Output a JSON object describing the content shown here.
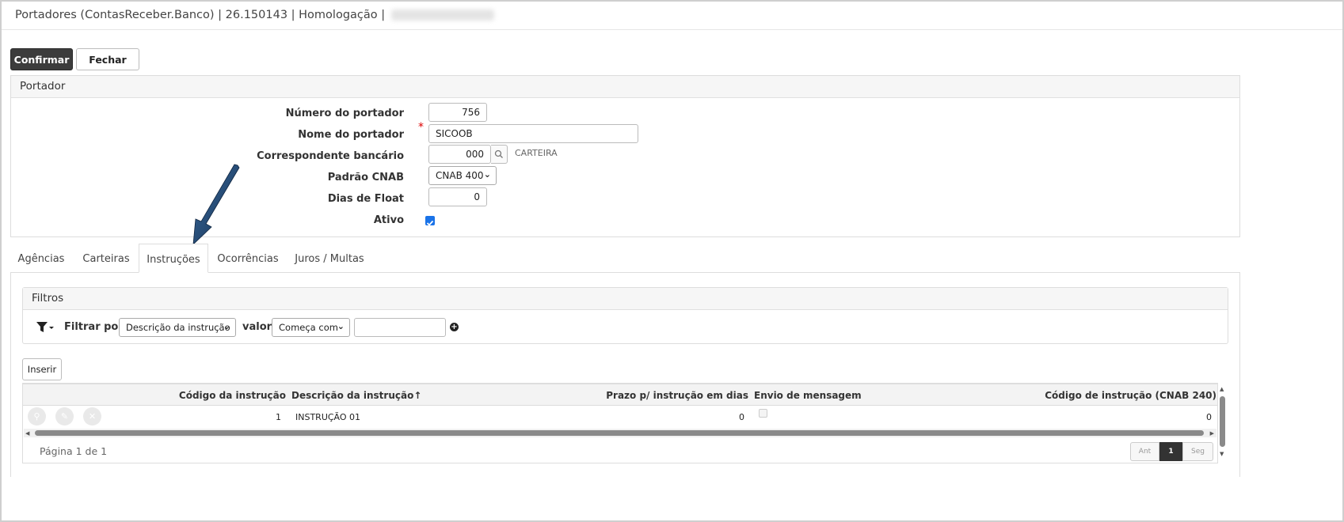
{
  "window": {
    "title": "Portadores (ContasReceber.Banco) | 26.150143 | Homologação |"
  },
  "toolbar": {
    "confirm_label": "Confirmar",
    "close_label": "Fechar"
  },
  "portador": {
    "section_title": "Portador",
    "fields": {
      "numero_label": "Número do portador",
      "numero_value": "756",
      "nome_label": "Nome do portador",
      "nome_value": "SICOOB",
      "required_mark": "*",
      "correspondente_label": "Correspondente bancário",
      "correspondente_value": "000",
      "correspondente_desc": "CARTEIRA",
      "cnab_label": "Padrão CNAB",
      "cnab_value": "CNAB 400",
      "float_label": "Dias de Float",
      "float_value": "0",
      "ativo_label": "Ativo",
      "ativo_checked": true
    }
  },
  "tabs": [
    "Agências",
    "Carteiras",
    "Instruções",
    "Ocorrências",
    "Juros / Multas"
  ],
  "active_tab": "Instruções",
  "filters": {
    "title": "Filtros",
    "filter_by_label": "Filtrar por",
    "field_value": "Descrição da instrução",
    "valor_label": "valor",
    "operator_value": "Começa com",
    "text_value": ""
  },
  "grid": {
    "insert_label": "Inserir",
    "columns": [
      "Código da instrução",
      "Descrição da instrução",
      "Prazo p/ instrução em dias",
      "Envio de mensagem",
      "Código de instrução (CNAB 240)"
    ],
    "sort_indicator": "↑",
    "rows": [
      {
        "codigo": "1",
        "descricao": "INSTRUÇÃO 01",
        "prazo": "0",
        "envio": false,
        "cnab240": "0"
      }
    ],
    "pagination": {
      "info": "Página 1 de 1",
      "prev": "Ant",
      "current": "1",
      "next": "Seg"
    }
  },
  "colors": {
    "primary_button": "#3c3c3c",
    "annotation_arrow": "#1d3e66",
    "checkbox": "#1a73e8"
  }
}
